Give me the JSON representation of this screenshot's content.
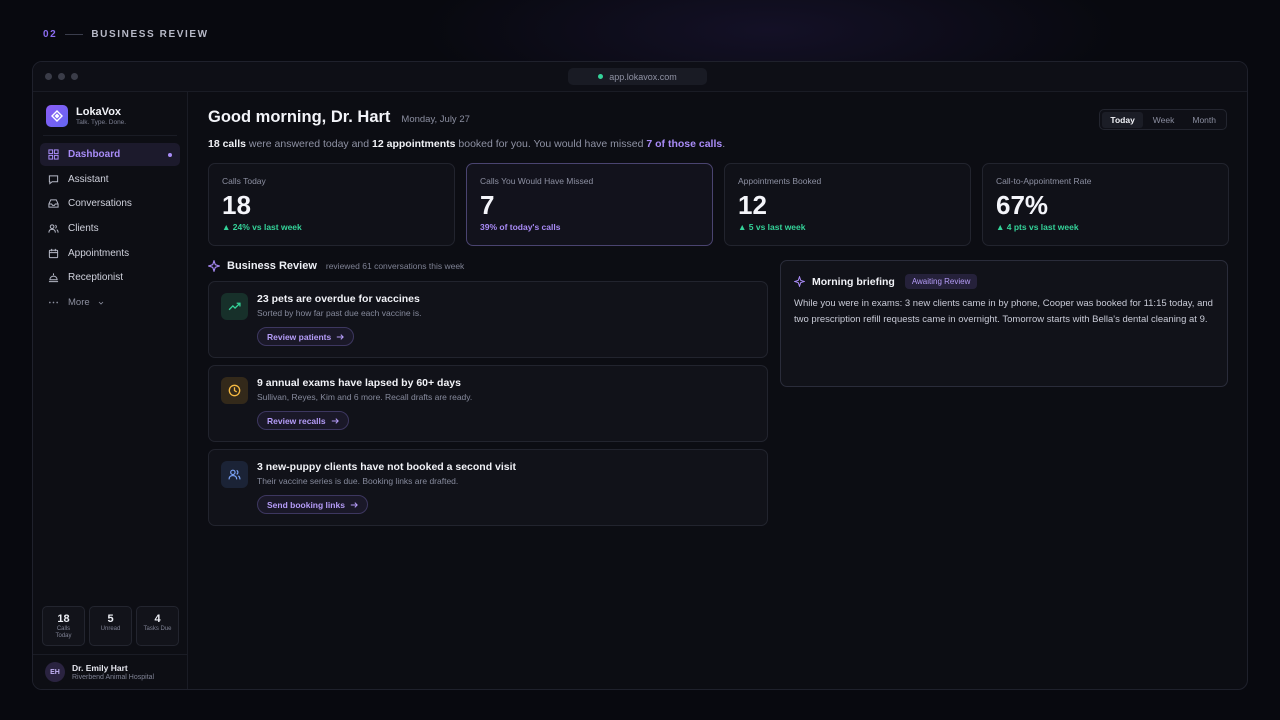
{
  "section": {
    "number": "02",
    "title": "BUSINESS REVIEW"
  },
  "browser": {
    "url": "app.lokavox.com"
  },
  "brand": {
    "name": "LokaVox",
    "tagline": "Talk. Type. Done."
  },
  "nav": {
    "items": [
      {
        "label": "Dashboard",
        "icon": "grid-icon",
        "active": true
      },
      {
        "label": "Assistant",
        "icon": "chat-icon"
      },
      {
        "label": "Conversations",
        "icon": "inbox-icon"
      },
      {
        "label": "Clients",
        "icon": "users-icon"
      },
      {
        "label": "Appointments",
        "icon": "calendar-icon"
      },
      {
        "label": "Receptionist",
        "icon": "desk-bell-icon"
      }
    ],
    "more_label": "More"
  },
  "sidebar_stats": [
    {
      "value": "18",
      "label": "Calls Today"
    },
    {
      "value": "5",
      "label": "Unread"
    },
    {
      "value": "4",
      "label": "Tasks Due"
    }
  ],
  "user": {
    "initials": "EH",
    "name": "Dr. Emily Hart",
    "org": "Riverbend Animal Hospital"
  },
  "header": {
    "greeting": "Good morning, Dr. Hart",
    "date": "Monday, July 27"
  },
  "summary": {
    "calls": "18 calls",
    "t1": " were answered today and ",
    "appointments": "12 appointments",
    "t2": " booked for you. You would have missed ",
    "missed": "7 of those calls",
    "t3": "."
  },
  "range": {
    "options": [
      "Today",
      "Week",
      "Month"
    ],
    "selected": "Today"
  },
  "kpis": [
    {
      "label": "Calls Today",
      "value": "18",
      "delta": "▲ 24% vs last week",
      "delta_color": "#34d399"
    },
    {
      "label": "Calls You Would Have Missed",
      "value": "7",
      "delta": "39% of today's calls",
      "delta_color": "#a98bf7",
      "highlight": true
    },
    {
      "label": "Appointments Booked",
      "value": "12",
      "delta": "▲ 5 vs last week",
      "delta_color": "#34d399"
    },
    {
      "label": "Call-to-Appointment Rate",
      "value": "67%",
      "delta": "▲ 4 pts vs last week",
      "delta_color": "#34d399"
    }
  ],
  "business_review": {
    "title": "Business Review",
    "subtitle": "reviewed 61 conversations this week",
    "cards": [
      {
        "icon": "trending-up-icon",
        "title": "23 pets are overdue for vaccines",
        "subtitle": "Sorted by how far past due each vaccine is.",
        "action": "Review patients"
      },
      {
        "icon": "clock-icon",
        "title": "9 annual exams have lapsed by 60+ days",
        "subtitle": "Sullivan, Reyes, Kim and 6 more. Recall drafts are ready.",
        "action": "Review recalls"
      },
      {
        "icon": "users-icon",
        "title": "3 new-puppy clients have not booked a second visit",
        "subtitle": "Their vaccine series is due. Booking links are drafted.",
        "action": "Send booking links"
      }
    ]
  },
  "briefing": {
    "title": "Morning briefing",
    "badge": "Awaiting Review",
    "body": "While you were in exams: 3 new clients came in by phone, Cooper was booked for 11:15 today, and two prescription refill requests came in overnight. Tomorrow starts with Bella's dental cleaning at 9."
  },
  "colors": {
    "accent": "#a98bf7",
    "positive": "#34d399",
    "background": "#08090f"
  }
}
